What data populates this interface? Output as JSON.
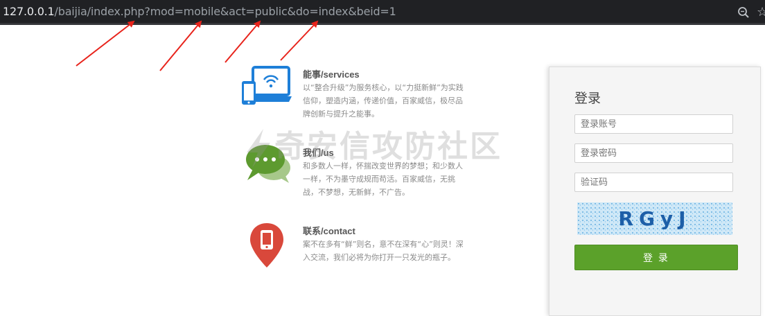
{
  "browser": {
    "url_host": "127.0.0.1",
    "url_path": "/baijia/index.php?mod=mobile&act=public&do=index&beid=1"
  },
  "features": [
    {
      "title": "能事/services",
      "desc": "以“整合升级”为服务核心，以“力挺新鲜”为实践信仰，塑造内涵，传递价值，百家威信，极尽品牌创新与提升之能事。"
    },
    {
      "title": "我们/us",
      "desc": "和多数人一样，怀揣改变世界的梦想；和少数人一样，不为墨守成规而苟活。百家威信，无挑战，不梦想，无新鲜，不广告。"
    },
    {
      "title": "联系/contact",
      "desc": "案不在多有“鲜”则名，意不在深有“心”则灵！深入交流，我们必将为你打开一只发光的瓶子。"
    }
  ],
  "watermark": {
    "text": "奇安信攻防社区"
  },
  "login": {
    "title": "登录",
    "account_placeholder": "登录账号",
    "password_placeholder": "登录密码",
    "captcha_placeholder": "验证码",
    "captcha_text": "RGyJ",
    "submit_label": "登 录"
  },
  "colors": {
    "arrow": "#e8231b",
    "button": "#5ba12a",
    "icon_blue": "#1e7fd8",
    "icon_green": "#5d9a2f",
    "icon_red": "#d9483b"
  },
  "icons": [
    "zoom-icon",
    "star-icon",
    "devices-wifi-icon",
    "chat-bubble-icon",
    "phone-pin-icon"
  ]
}
